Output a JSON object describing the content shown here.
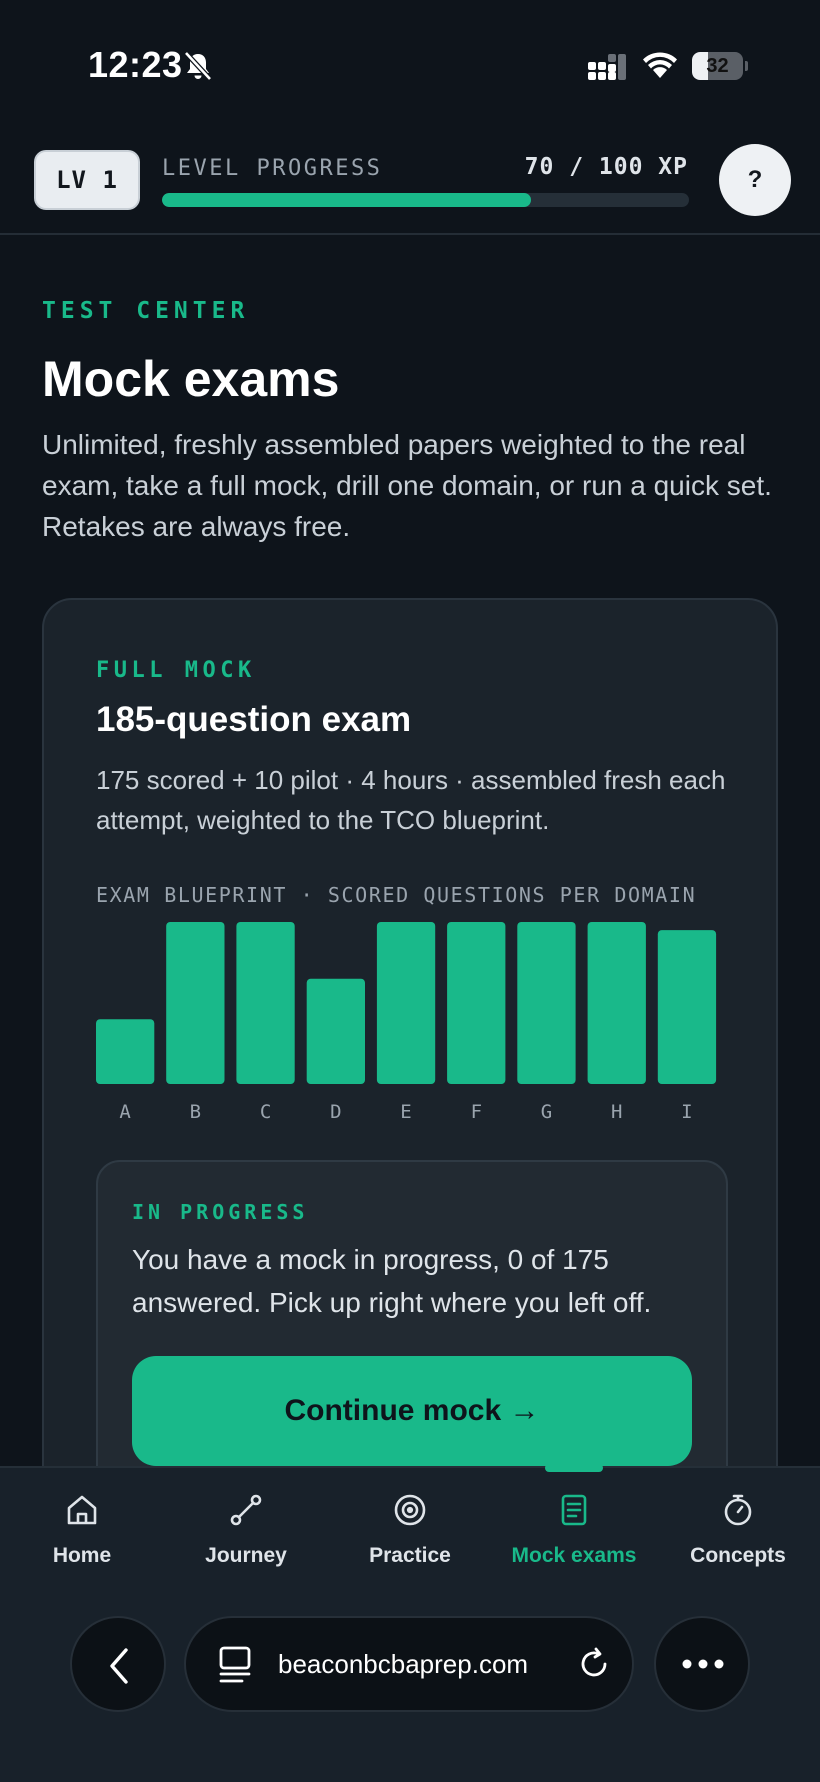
{
  "status_bar": {
    "time": "12:23",
    "battery_percent": "32",
    "battery_level": 0.32,
    "icons": [
      "bell-slash-icon",
      "signal-icon",
      "wifi-icon",
      "battery-icon"
    ]
  },
  "level": {
    "badge": "LV 1",
    "label": "LEVEL PROGRESS",
    "xp_text": "70 / 100 XP",
    "progress": 0.7,
    "help_label": "?"
  },
  "hero": {
    "eyebrow": "TEST CENTER",
    "title": "Mock exams",
    "description": "Unlimited, freshly assembled papers weighted to the real exam, take a full mock, drill one domain, or run a quick set. Retakes are always free."
  },
  "card": {
    "eyebrow": "FULL MOCK",
    "title": "185-question exam",
    "description": "175 scored + 10 pilot · 4 hours · assembled fresh each attempt, weighted to the TCO blueprint.",
    "blueprint_label": "EXAM BLUEPRINT · SCORED QUESTIONS PER DOMAIN"
  },
  "chart_data": {
    "type": "bar",
    "categories": [
      "A",
      "B",
      "C",
      "D",
      "E",
      "F",
      "G",
      "H",
      "I"
    ],
    "values": [
      8,
      20,
      20,
      13,
      20,
      20,
      20,
      20,
      19
    ],
    "ylim": [
      0,
      20
    ],
    "grid": false,
    "color": "#19b98a"
  },
  "in_progress": {
    "eyebrow": "IN PROGRESS",
    "text": "You have a mock in progress, 0 of 175 answered. Pick up right where you left off.",
    "button_label": "Continue mock →"
  },
  "nav": {
    "items": [
      {
        "label": "Home",
        "icon": "home-icon"
      },
      {
        "label": "Journey",
        "icon": "route-icon"
      },
      {
        "label": "Practice",
        "icon": "target-icon"
      },
      {
        "label": "Mock exams",
        "icon": "document-icon"
      },
      {
        "label": "Concepts",
        "icon": "stopwatch-icon"
      }
    ],
    "active": "Mock exams"
  },
  "browser": {
    "url": "beaconbcbaprep.com"
  },
  "colors": {
    "background": "#0e141b",
    "accent": "#19b98a",
    "card": "#1b232b"
  }
}
